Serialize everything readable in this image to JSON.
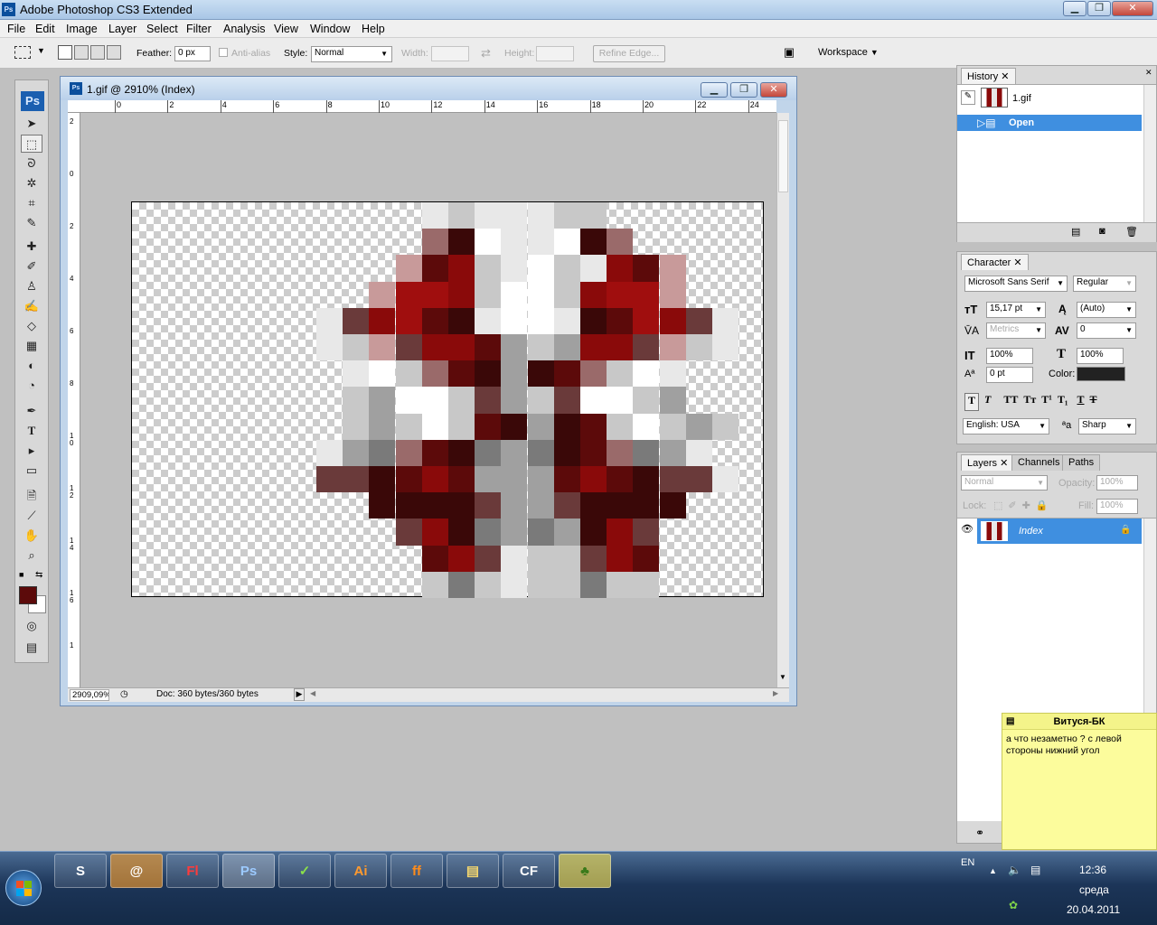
{
  "app": {
    "title": "Adobe Photoshop CS3 Extended",
    "logo": "Ps"
  },
  "menu": [
    "File",
    "Edit",
    "Image",
    "Layer",
    "Select",
    "Filter",
    "Analysis",
    "View",
    "Window",
    "Help"
  ],
  "options": {
    "feather_label": "Feather:",
    "feather_value": "0 px",
    "antialias_label": "Anti-alias",
    "style_label": "Style:",
    "style_value": "Normal",
    "width_label": "Width:",
    "height_label": "Height:",
    "refine_edge": "Refine Edge...",
    "workspace": "Workspace"
  },
  "toolbox": {
    "logo": "Ps",
    "foreground_color": "#5c0a0a",
    "background_color": "#ffffff"
  },
  "document": {
    "title": "1.gif @ 2910% (Index)",
    "zoom": "2909,09%",
    "doc_info": "Doc: 360 bytes/360 bytes",
    "ruler_h": [
      "0",
      "2",
      "4",
      "6",
      "8",
      "10",
      "12",
      "14",
      "16",
      "18",
      "20",
      "22",
      "24"
    ],
    "ruler_v": [
      "2",
      "0",
      "2",
      "4",
      "6",
      "8",
      "1 0",
      "1 2",
      "1 4",
      "1 6",
      "1"
    ]
  },
  "history": {
    "tab": "History",
    "snapshot": "1.gif",
    "items": [
      {
        "label": "Open"
      }
    ]
  },
  "character": {
    "tab": "Character",
    "font": "Microsoft Sans Serif",
    "style": "Regular",
    "size": "15,17 pt",
    "leading": "(Auto)",
    "kerning": "Metrics",
    "tracking": "0",
    "vscale": "100%",
    "hscale": "100%",
    "baseline": "0 pt",
    "color_label": "Color:",
    "language": "English: USA",
    "antialias": "Sharp"
  },
  "layers": {
    "tabs": [
      "Layers",
      "Channels",
      "Paths"
    ],
    "blend": "Normal",
    "opacity_label": "Opacity:",
    "opacity": "100%",
    "lock_label": "Lock:",
    "fill_label": "Fill:",
    "fill": "100%",
    "items": [
      {
        "name": "Index"
      }
    ]
  },
  "note": {
    "title": "Витуся-БК",
    "body": "а что незаметно ? с левой стороны нижний угол"
  },
  "taskbar": {
    "apps": [
      "S",
      "@",
      "Fl",
      "Ps",
      "✓",
      "Ai",
      "ff",
      "▤",
      "CF",
      "♣"
    ],
    "language": "EN",
    "time": "12:36",
    "day": "среда",
    "date": "20.04.2011"
  }
}
